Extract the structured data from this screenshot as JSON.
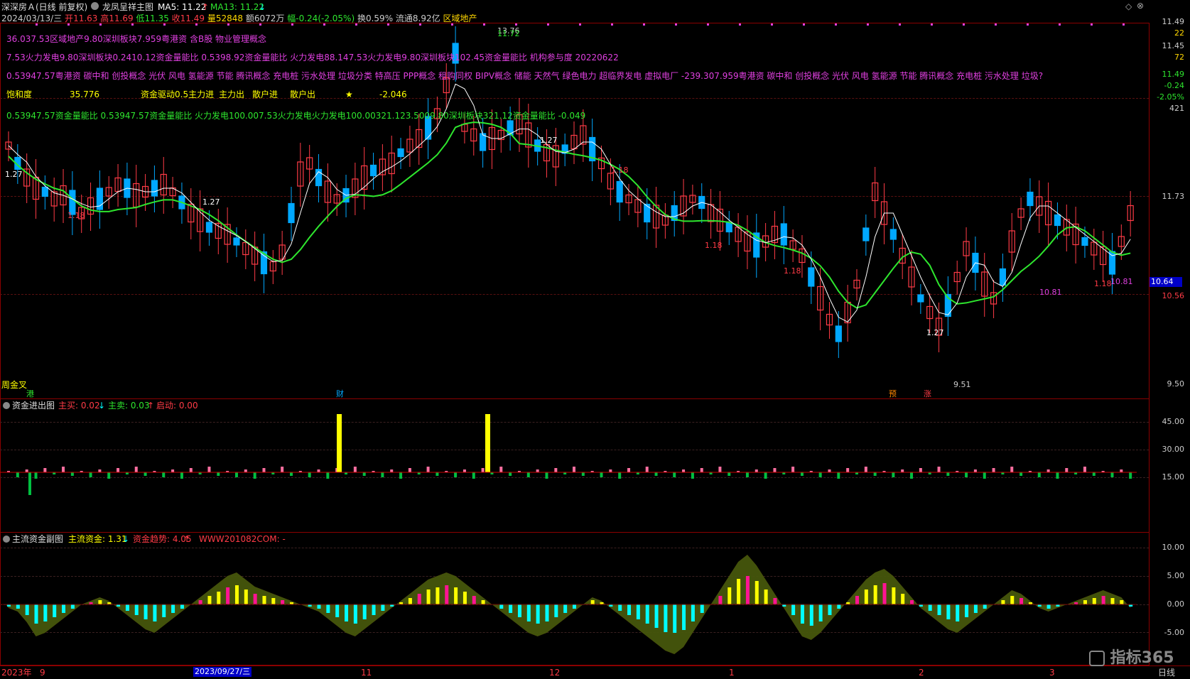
{
  "header": {
    "stock": "深深房Ａ(日线 前复权)",
    "date": "2024/03/13/三",
    "open_label": "开",
    "open": "11.63",
    "high_label": "高",
    "high": "11.69",
    "low_label": "低",
    "low": "11.35",
    "close_label": "收",
    "close": "11.49",
    "volume_label": "量",
    "volume": "52848",
    "amount": "额6072万",
    "change": "幅-0.24(-2.05%)",
    "turnover": "换0.59%",
    "float": "流通8.92亿",
    "sector": "区域地产",
    "indicator_name": "龙凤呈祥主图",
    "ma5": "MA5: 11.22",
    "ma5_arrow": "↑",
    "ma13": "MA13: 11.22",
    "ma13_arrow": "↓"
  },
  "main_text_lines": {
    "line1": "36.037.53区域地产9.80深圳板块7.959粤港资 含B股 物业管理概念",
    "line2": "7.53火力发电9.80深圳板块0.2410.12资金量能比   0.5398.92资金量能比    火力发电88.147.53火力发电9.80深圳板块102.45资金量能比    机构参与度      20220622",
    "line3": "0.53947.57粤港资 碳中和 创投概念 光伏 风电 氢能源 节能 腾讯概念 充电桩 污水处理 垃圾分类 特高压 PPP概念 租购同权 BIPV概念 储能 天然气 绿色电力 超临界发电 虚拟电厂 -239.307.959粤港资 碳中和 创投概念 光伏 风电 氢能源 节能 腾讯概念 充电桩 污水处理 垃圾?",
    "line4_a": "饱和度",
    "line4_b": "35.776",
    "line4_c": "资金驱动0.5主力进",
    "line4_d": "主力出",
    "line4_e": "散户进",
    "line4_f": "散户出",
    "line4_star": "★",
    "line4_g": "-2.046",
    "line5": "0.53947.57资金量能比   0.53947.57资金量能比    火力发电100.007.53火力发电火力发电100.00321.123.5009.80深圳板块321.12资金量能比   -0.049"
  },
  "main_axis": {
    "labels": [
      "11.49",
      "22",
      "11.45",
      "72",
      "11.49",
      "-0.24",
      "-2.05%",
      "421",
      "11.73",
      "10.64",
      "10.56",
      "9.50"
    ],
    "current_price": "10.64"
  },
  "main_annotations": {
    "high_mark": "13.76",
    "high_mark2": "11.72",
    "low_mark": "9.51",
    "val_127a": "1.27",
    "val_127b": "1.27",
    "val_127c": "1.27",
    "val_127d": "1.27",
    "val_118a": "1.18",
    "val_118b": "1.18",
    "val_118c": "1.18",
    "val_118d": "1.18",
    "val_118e": "1.18",
    "val_1081a": "10.81",
    "val_1081b": "10.81",
    "weekly_cross": "周金叉",
    "tag_gang": "港",
    "tag_cai": "财",
    "tag_yu": "预",
    "tag_zhang": "涨"
  },
  "sub1": {
    "title": "资金进出图",
    "zhu_mai_label": "主买: 0.02",
    "zhu_mai_arrow": "↓",
    "zhu_mai2_label": "主卖: 0.03",
    "zhu_mai2_arrow": "↑",
    "qidong_label": "启动: 0.00",
    "axis": [
      "45.00",
      "30.00",
      "15.00"
    ]
  },
  "sub2": {
    "title": "主流资金副图",
    "main_label": "主流资金: 1.31",
    "main_arrow": "↓",
    "trend_label": "资金趋势: 4.05",
    "trend_arrow": "↑",
    "url_label": "WWW201082COM: -",
    "axis": [
      "10.00",
      "5.00",
      "0.00",
      "-5.00"
    ]
  },
  "time_axis": {
    "year": "2023年",
    "m9": "9",
    "cursor_date": "2023/09/27/三",
    "m11": "11",
    "m12": "12",
    "m1": "1",
    "m2": "2",
    "m3": "3",
    "period": "日线"
  },
  "brand": "指标365",
  "colors": {
    "up": "#ff3b46",
    "down": "#00a8ff",
    "ma13": "#2ee62e",
    "ma5": "#ffffff",
    "magenta": "#e040e0",
    "yellow": "#ffff00",
    "cyan": "#00ffff"
  },
  "chart_data": {
    "type": "bar",
    "title": "",
    "xlabel": "",
    "ylabel": "",
    "ylim": [
      9.5,
      13.8
    ],
    "categories": [],
    "values": []
  }
}
